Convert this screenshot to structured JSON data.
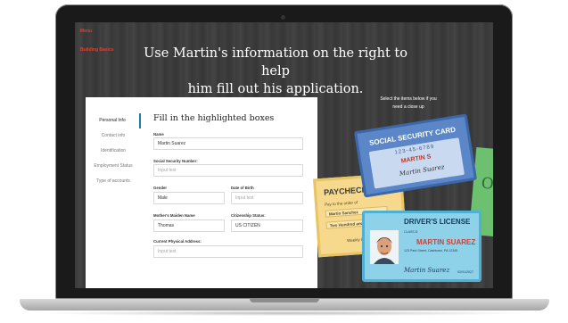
{
  "header": {
    "menu_link": "Menu",
    "building_link": "Building Basics",
    "headline_line1": "Use Martin's information on the right to help",
    "headline_line2": "him fill out his application."
  },
  "hint": {
    "line1": "Select the items below if you",
    "line2": "need a close up"
  },
  "nav": {
    "items": [
      "Personal Info",
      "Contact info",
      "Identification",
      "Employment Status",
      "Type of accounts"
    ]
  },
  "form": {
    "title": "Fill in the highlighted boxes",
    "name_label": "Name",
    "name_value": "Martin Suarez",
    "ssn_label": "Social Security Number:",
    "ssn_placeholder": "Input text",
    "gender_label": "Gender",
    "gender_value": "Male",
    "dob_label": "Date of Birth",
    "dob_placeholder": "Input text",
    "maiden_label": "Mother's Maiden Name",
    "maiden_value": "Thomas",
    "citizenship_label": "Citizenship Status:",
    "citizenship_value": "US CITIZEN",
    "address_label": "Current Physical Address:",
    "address_placeholder": "Input text"
  },
  "cards": {
    "ssc_title": "SOCIAL SECURITY CARD",
    "ssc_number": "123-45-6789",
    "ssc_name": "MARTIN S",
    "paycheck_title": "PAYCHECK",
    "paycheck_payto": "Pay to the order of",
    "paycheck_payee": "Martin Sanchez",
    "paycheck_amount": "Two Hundred and",
    "paycheck_footer": "Weekly Pay",
    "dl_title": "DRIVER'S LICENSE",
    "dl_name": "MARTIN SUAREZ",
    "dl_line1": "CLASS D",
    "dl_line2": "123 Park Street, Cashtown, PA 12345",
    "dl_date": "02/01/2027",
    "green_glyph": "O"
  }
}
